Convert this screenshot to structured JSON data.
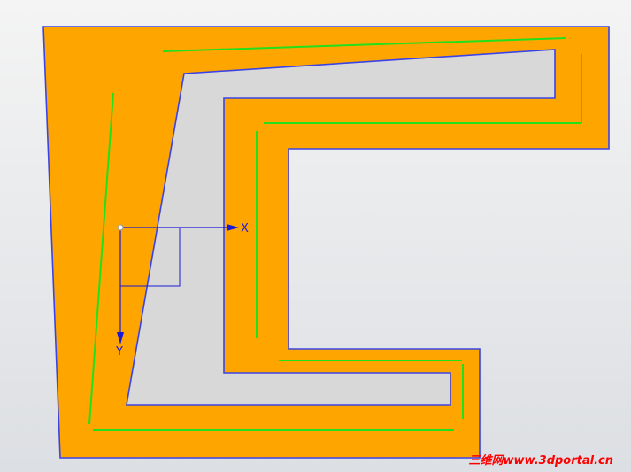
{
  "colors": {
    "background_top": "#f4f4f4",
    "background_bottom": "#dcdfe3",
    "outer_fill": "#ffa500",
    "inner_fill": "#d8d8d8",
    "edge": "#3a44e6",
    "offset_curve": "#22e01a",
    "axis": "#1a1ad6",
    "watermark": "#ff0000"
  },
  "sketch": {
    "axis_x_label": "X",
    "axis_y_label": "Y"
  },
  "watermark": {
    "text": "三维网www.3dportal.cn"
  }
}
